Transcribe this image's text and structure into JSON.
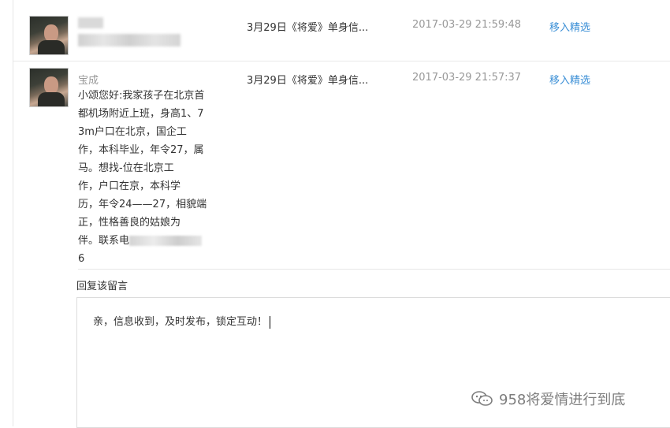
{
  "messages": [
    {
      "topic": "3月29日《将爱》单身信...",
      "time": "2017-03-29 21:59:48",
      "action": "移入精选"
    },
    {
      "user": "宝成",
      "topic": "3月29日《将爱》单身信...",
      "time": "2017-03-29 21:57:37",
      "action": "移入精选",
      "body_lines": [
        "小颂您好:我家孩子在北京首",
        "都机场附近上班，身高1、7",
        "3m户口在北京，国企工",
        "作，本科毕业，年令27，属",
        "马。想找-位在北京工",
        "作，户口在京，本科学",
        "历，年令24——27，相貌端",
        "正，性格善良的姑娘为",
        "伴。联系电"
      ],
      "body_last": "6"
    }
  ],
  "reply": {
    "label": "回复该留言",
    "text": "亲，信息收到，及时发布，锁定互动！"
  },
  "watermark": {
    "text": "958将爱情进行到底",
    "icon": "wechat-icon"
  }
}
